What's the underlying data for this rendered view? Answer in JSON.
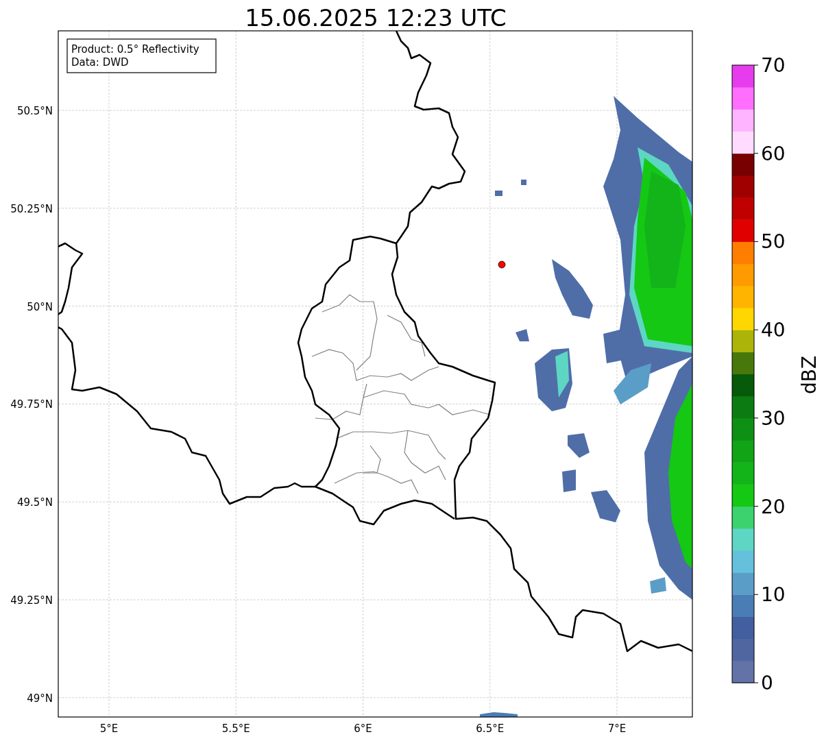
{
  "title": "15.06.2025 12:23 UTC",
  "info_box": {
    "lines": [
      "Product: 0.5° Reflectivity",
      "Data: DWD"
    ]
  },
  "map": {
    "lat_labels": [
      "50.5°N",
      "50.25°N",
      "50°N",
      "49.75°N",
      "49.5°N",
      "49.25°N",
      "49°N"
    ],
    "lon_labels": [
      "5°E",
      "5.5°E",
      "6°E",
      "6.5°E",
      "7°E"
    ]
  },
  "colorbar": {
    "label": "dBZ",
    "tick_labels": [
      "70",
      "60",
      "50",
      "40",
      "30",
      "20",
      "10",
      "0"
    ],
    "segments": [
      {
        "color": "#6373a8"
      },
      {
        "color": "#5066a0"
      },
      {
        "color": "#425fa0"
      },
      {
        "color": "#4a7db5"
      },
      {
        "color": "#5a9ec8"
      },
      {
        "color": "#64c0dc"
      },
      {
        "color": "#5dd6c4"
      },
      {
        "color": "#3cd26e"
      },
      {
        "color": "#14c814"
      },
      {
        "color": "#12b41a"
      },
      {
        "color": "#10a416"
      },
      {
        "color": "#0e9014"
      },
      {
        "color": "#0c7c12"
      },
      {
        "color": "#065a0a"
      },
      {
        "color": "#48780c"
      },
      {
        "color": "#acb40a"
      },
      {
        "color": "#ffd700"
      },
      {
        "color": "#ffb400"
      },
      {
        "color": "#ff9a00"
      },
      {
        "color": "#ff7d00"
      },
      {
        "color": "#e10000"
      },
      {
        "color": "#c00000"
      },
      {
        "color": "#a00000"
      },
      {
        "color": "#780000"
      },
      {
        "color": "#ffdcff"
      },
      {
        "color": "#ffb4ff"
      },
      {
        "color": "#ff6eff"
      },
      {
        "color": "#e63ced"
      }
    ]
  }
}
